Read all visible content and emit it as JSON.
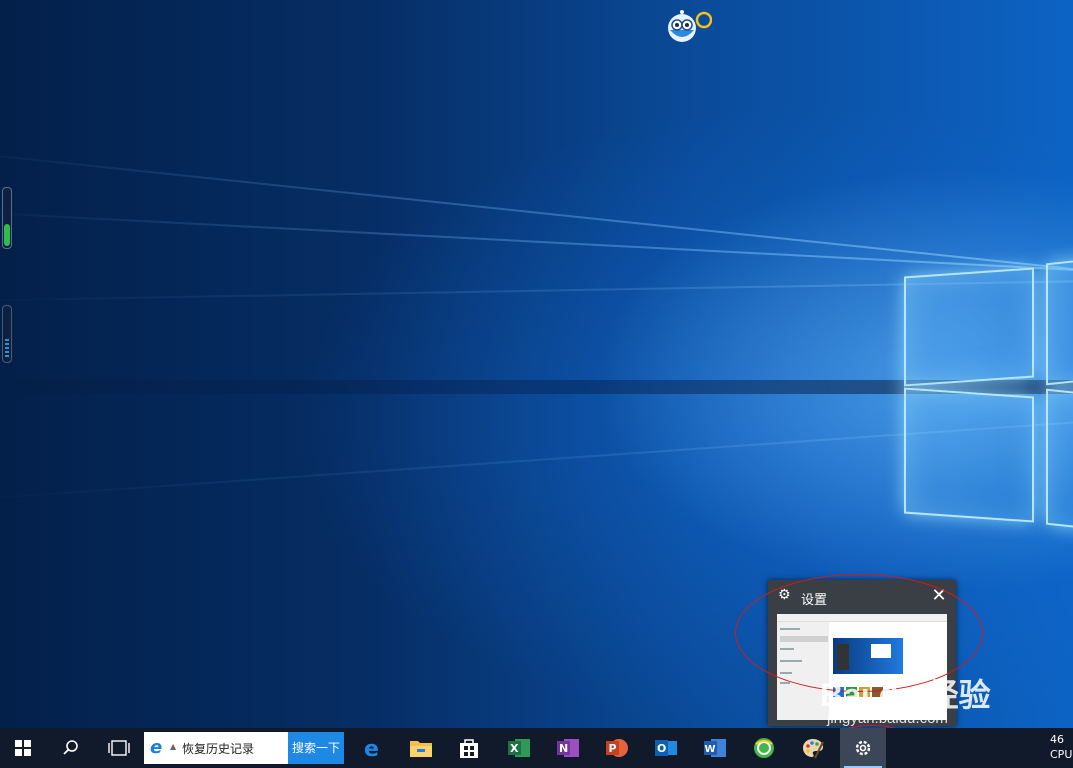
{
  "taskbar": {
    "search": {
      "text": "恢复历史记录",
      "button_label": "搜索一下"
    },
    "apps": [
      {
        "name": "edge",
        "label": "e"
      },
      {
        "name": "file-explorer"
      },
      {
        "name": "store"
      },
      {
        "name": "excel",
        "label": "X"
      },
      {
        "name": "onenote",
        "label": "N"
      },
      {
        "name": "powerpoint",
        "label": "P"
      },
      {
        "name": "outlook",
        "label": "O"
      },
      {
        "name": "word",
        "label": "W"
      },
      {
        "name": "browser-360"
      },
      {
        "name": "paint"
      },
      {
        "name": "settings",
        "active": true
      }
    ],
    "tray": {
      "line1": "46",
      "line2": "CPU"
    }
  },
  "thumbnail": {
    "title": "设置",
    "icons": {
      "app": "gear-icon",
      "close": "close-icon"
    }
  },
  "watermark": {
    "brand": "Bai du 经验",
    "url": "jingyan.baidu.com"
  },
  "colors": {
    "taskbar": "#101a2b",
    "accent": "#1e88e5",
    "annotation": "#d31b1b"
  }
}
